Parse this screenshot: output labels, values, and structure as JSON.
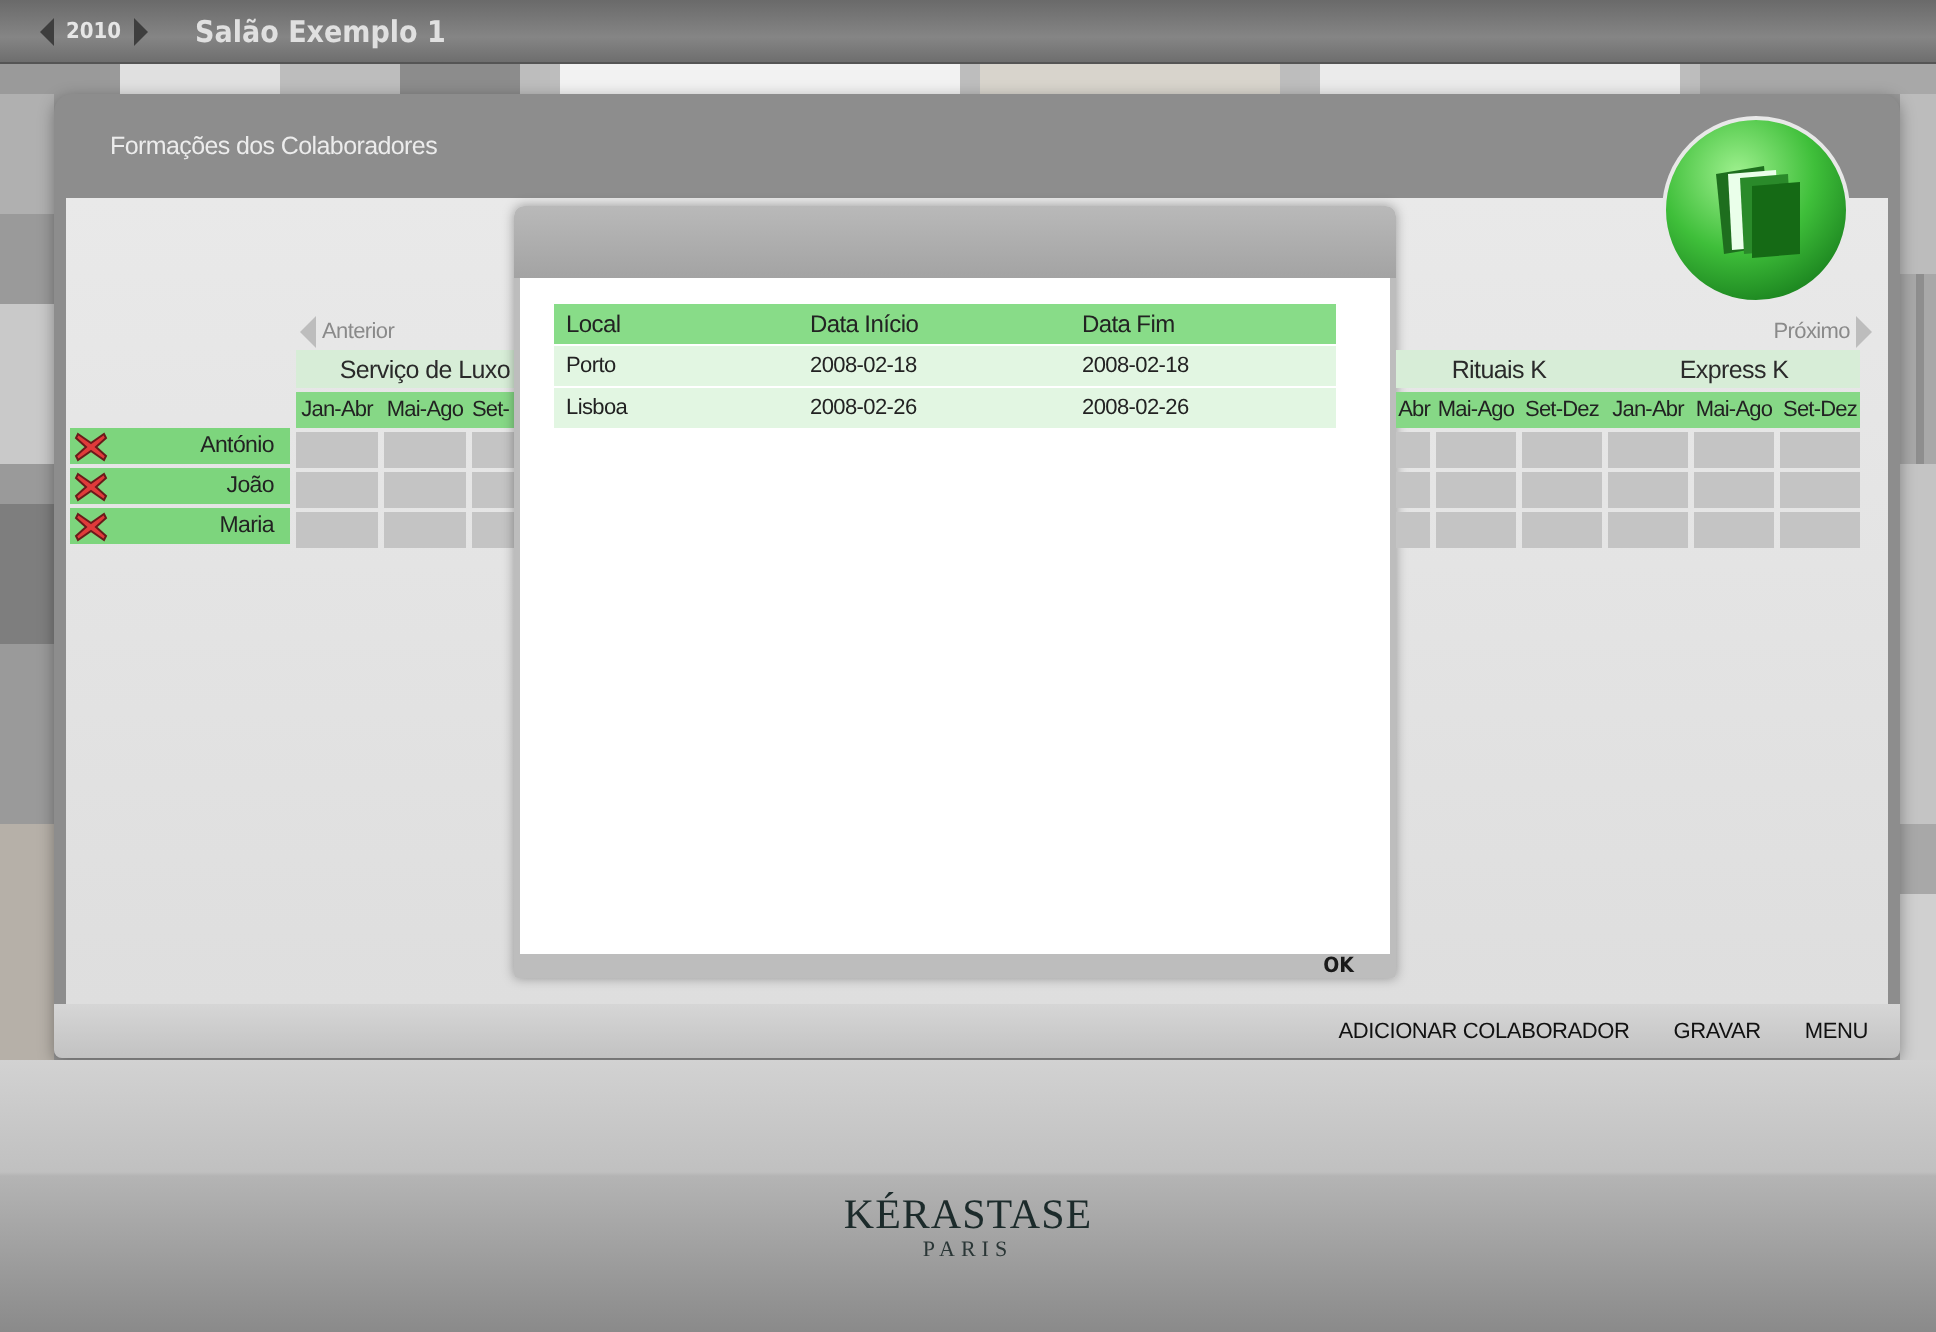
{
  "header": {
    "year": "2010",
    "title": "Salão Exemplo 1"
  },
  "panel": {
    "title": "Formações dos Colaboradores"
  },
  "navigation": {
    "previous": "Anterior",
    "next": "Próximo"
  },
  "grid_left": {
    "groups": [
      {
        "label": "Serviço de Luxo",
        "periods": [
          "Jan-Abr",
          "Mai-Ago",
          "Set-"
        ]
      }
    ]
  },
  "grid_right": {
    "groups": [
      {
        "label": "Rituais K",
        "periods": [
          "Abr",
          "Mai-Ago",
          "Set-Dez"
        ]
      },
      {
        "label": "Express K",
        "periods": [
          "Jan-Abr",
          "Mai-Ago",
          "Set-Dez"
        ]
      }
    ]
  },
  "collaborators": [
    {
      "name": "António"
    },
    {
      "name": "João"
    },
    {
      "name": "Maria"
    }
  ],
  "dialog": {
    "columns": [
      "Local",
      "Data Início",
      "Data Fim"
    ],
    "rows": [
      [
        "Porto",
        "2008-02-18",
        "2008-02-18"
      ],
      [
        "Lisboa",
        "2008-02-26",
        "2008-02-26"
      ]
    ],
    "ok": "OK"
  },
  "actions": [
    "ADICIONAR COLABORADOR",
    "GRAVAR",
    "MENU"
  ],
  "footer": {
    "brand": "KÉRASTASE",
    "tagline": "PARIS"
  }
}
